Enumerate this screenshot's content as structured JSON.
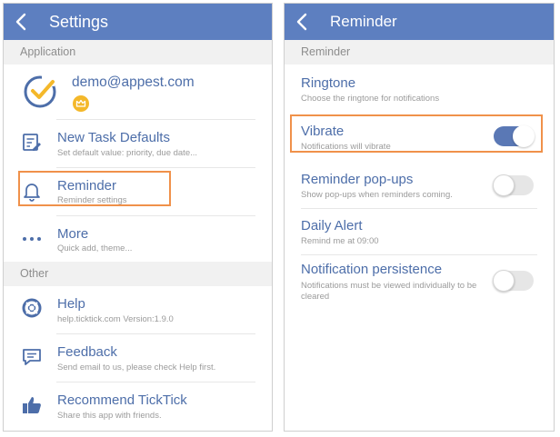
{
  "left": {
    "title": "Settings",
    "section_application": "Application",
    "account_email": "demo@appest.com",
    "items": [
      {
        "title": "New Task Defaults",
        "subtitle": "Set default value: priority, due date..."
      },
      {
        "title": "Reminder",
        "subtitle": "Reminder settings"
      },
      {
        "title": "More",
        "subtitle": "Quick add, theme..."
      }
    ],
    "section_other": "Other",
    "other_items": [
      {
        "title": "Help",
        "subtitle": "help.ticktick.com  Version:1.9.0"
      },
      {
        "title": "Feedback",
        "subtitle": "Send email to us, please check Help first."
      },
      {
        "title": "Recommend TickTick",
        "subtitle": "Share this app with friends."
      }
    ]
  },
  "right": {
    "title": "Reminder",
    "section_reminder": "Reminder",
    "items": [
      {
        "title": "Ringtone",
        "subtitle": "Choose the ringtone for notifications"
      },
      {
        "title": "Vibrate",
        "subtitle": "Notifications will vibrate",
        "toggle_on": true
      },
      {
        "title": "Reminder pop-ups",
        "subtitle": "Show pop-ups when reminders coming.",
        "toggle_on": false
      },
      {
        "title": "Daily Alert",
        "subtitle": "Remind me at 09:00"
      },
      {
        "title": "Notification persistence",
        "subtitle_line1": "Notifications must be viewed individually to be",
        "subtitle_line2": "cleared",
        "toggle_on": false
      }
    ]
  },
  "colors": {
    "appbar": "#5d7fc0",
    "item_title": "#4d6ea9",
    "highlight": "#f0914a",
    "toggle_on": "#5a78b5"
  }
}
